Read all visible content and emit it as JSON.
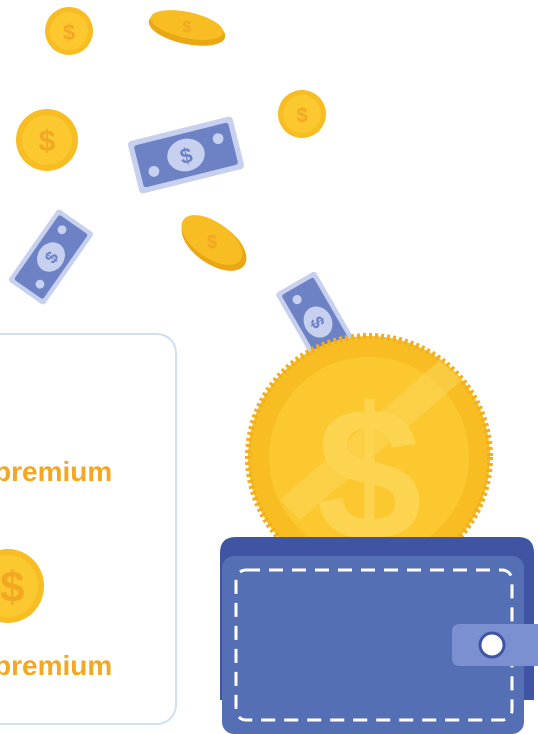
{
  "card": {
    "items": [
      {
        "label": "premium",
        "icon": "coin-icon"
      },
      {
        "label": "premium",
        "icon": "coin-icon"
      }
    ]
  },
  "illustration": {
    "icons": [
      "coin-icon",
      "banknote-icon",
      "wallet-icon",
      "dollar-sign-icon"
    ],
    "colors": {
      "coin": "#f7bd22",
      "coin_dark": "#ecaa16",
      "coin_light": "#fbd453",
      "banknote": "#6d82c4",
      "banknote_light": "#c7d1ef",
      "wallet": "#556fb5",
      "wallet_dark": "#3f55a3",
      "card_border": "#cfe0f3",
      "label": "#f3a723"
    }
  }
}
